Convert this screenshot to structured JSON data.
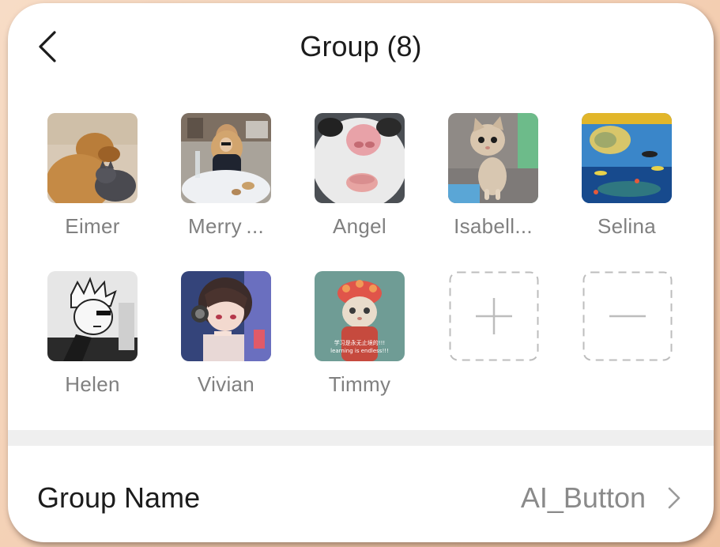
{
  "header": {
    "title": "Group (8)"
  },
  "members": [
    {
      "name": "Eimer",
      "avatar": "dog-and-cat-avatar"
    },
    {
      "name": "Merry ...",
      "avatar": "woman-dining-avatar"
    },
    {
      "name": "Angel",
      "avatar": "cat-closeup-avatar"
    },
    {
      "name": "Isabell...",
      "avatar": "kitten-avatar"
    },
    {
      "name": "Selina",
      "avatar": "fish-aquarium-avatar"
    },
    {
      "name": "Helen",
      "avatar": "manga-boy-avatar"
    },
    {
      "name": "Vivian",
      "avatar": "anime-girl-headphones-avatar"
    },
    {
      "name": "Timmy",
      "avatar": "cat-in-costume-avatar",
      "caption_lines": [
        "学习是永无止境的!!!",
        "learning is endless!!!"
      ]
    }
  ],
  "actions": {
    "add_icon": "plus-icon",
    "remove_icon": "minus-icon"
  },
  "settings": {
    "group_name_label": "Group Name",
    "group_name_value": "AI_Button"
  },
  "colors": {
    "text_primary": "#1c1c1c",
    "text_secondary": "#808080",
    "divider": "#efefef",
    "dash_border": "#bdbdbd"
  }
}
